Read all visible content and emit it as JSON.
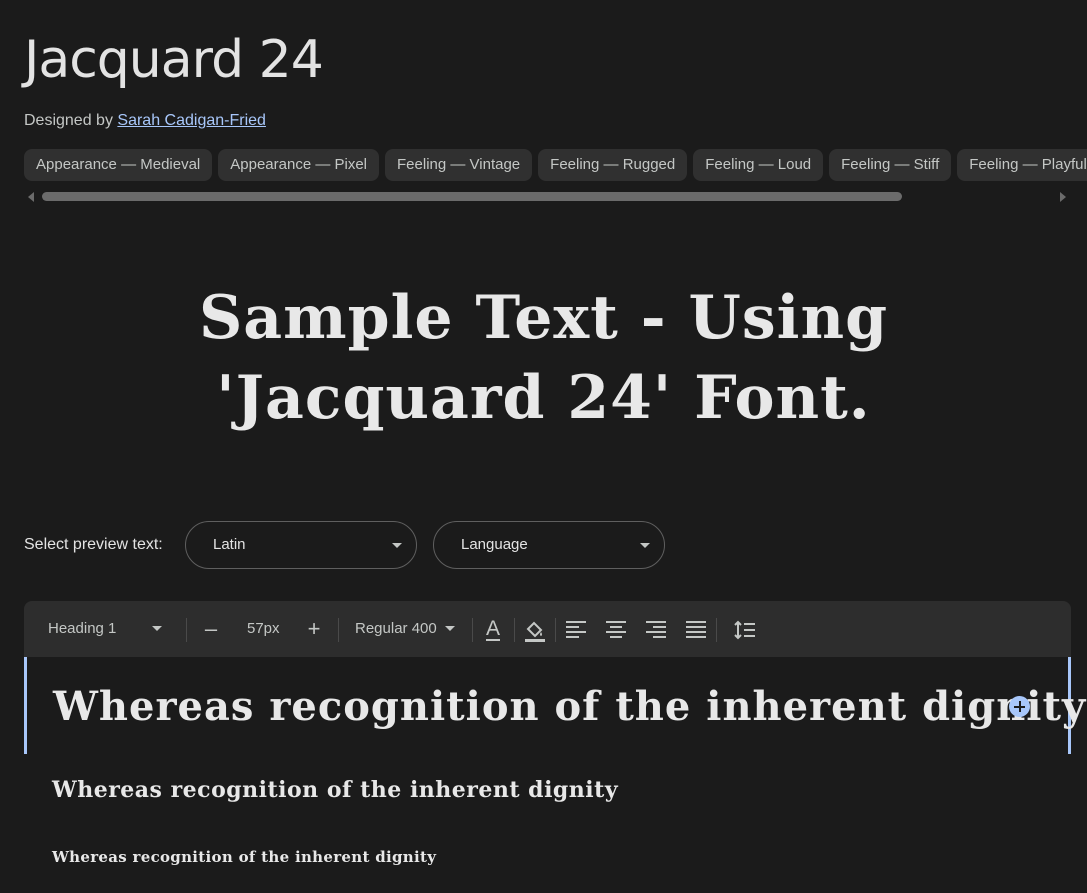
{
  "title": "Jacquard 24",
  "designer": {
    "prefix": "Designed by",
    "name": "Sarah Cadigan-Fried"
  },
  "tags": [
    "Appearance — Medieval",
    "Appearance — Pixel",
    "Feeling — Vintage",
    "Feeling — Rugged",
    "Feeling — Loud",
    "Feeling — Stiff",
    "Feeling — Playful"
  ],
  "hero_text": "Sample Text - Using 'Jacquard 24' Font.",
  "preview": {
    "label": "Select preview text:",
    "script_value": "Latin",
    "language_value": "Language"
  },
  "toolbar": {
    "style_value": "Heading 1",
    "decrease_label": "–",
    "size_value": "57px",
    "increase_label": "+",
    "weight_value": "Regular 400",
    "text_color_label": "A"
  },
  "samples": {
    "heading1": "Whereas recognition of the inherent dignity",
    "heading2": "Whereas recognition of the inherent dignity",
    "heading3": "Whereas recognition of the inherent dignity"
  },
  "colors": {
    "background": "#1b1b1b",
    "accent": "#a8c7fa",
    "chip": "#303030",
    "toolbar": "#2d2d2d"
  }
}
